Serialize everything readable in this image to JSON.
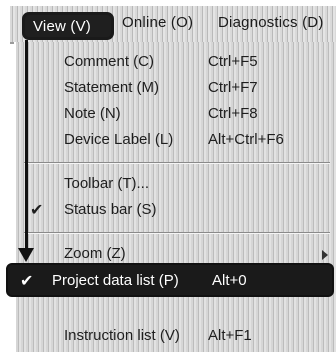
{
  "menubar": {
    "view": "View (V)",
    "online": "Online (O)",
    "diagnostics": "Diagnostics (D)"
  },
  "menu": {
    "comment": {
      "label": "Comment (C)",
      "shortcut": "Ctrl+F5"
    },
    "statement": {
      "label": "Statement (M)",
      "shortcut": "Ctrl+F7"
    },
    "note": {
      "label": "Note (N)",
      "shortcut": "Ctrl+F8"
    },
    "device_label": {
      "label": "Device Label (L)",
      "shortcut": "Alt+Ctrl+F6"
    },
    "toolbar": {
      "label": "Toolbar (T)..."
    },
    "status_bar": {
      "label": "Status bar (S)",
      "check": "✔"
    },
    "zoom": {
      "label": "Zoom (Z)"
    },
    "project_data_list": {
      "label": "Project data list (P)",
      "shortcut": "Alt+0",
      "check": "✔"
    },
    "instruction_list": {
      "label": "Instruction list (V)",
      "shortcut": "Alt+F1"
    }
  },
  "icons": {
    "check": "checkmark-icon",
    "submenu": "submenu-arrow-icon",
    "callout": "callout-arrow-icon"
  }
}
